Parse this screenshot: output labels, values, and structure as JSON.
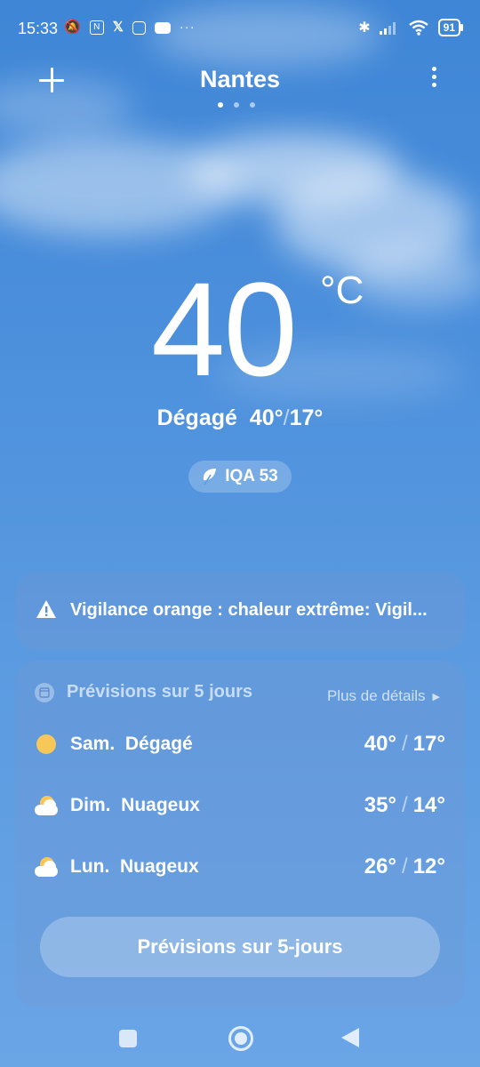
{
  "status_bar": {
    "time": "15:33",
    "battery": "91",
    "left_icons": [
      "alarm-off-icon",
      "nfc-icon",
      "x-icon",
      "instagram-icon",
      "youtube-icon",
      "more-icon"
    ],
    "right_icons": [
      "bluetooth-icon",
      "signal-icon",
      "wifi-icon",
      "battery-icon"
    ]
  },
  "header": {
    "city": "Nantes",
    "pages": 3,
    "active_page": 0
  },
  "current": {
    "temperature": "40",
    "unit": "°C",
    "condition": "Dégagé",
    "high": "40°",
    "separator": "/",
    "low": "17°",
    "aqi_label": "IQA 53"
  },
  "alert": {
    "text": "Vigilance orange : chaleur extrême: Vigil..."
  },
  "forecast": {
    "title": "Prévisions sur 5 jours",
    "details_label": "Plus de détails",
    "days": [
      {
        "label": "Sam.  Dégagé",
        "high": "40°",
        "low": "17°",
        "icon": "sun-icon"
      },
      {
        "label": "Dim.  Nuageux",
        "high": "35°",
        "low": "14°",
        "icon": "partly-cloudy-icon"
      },
      {
        "label": "Lun.  Nuageux",
        "high": "26°",
        "low": "12°",
        "icon": "partly-cloudy-icon"
      }
    ],
    "slash": "/",
    "button_label": "Prévisions sur 5-jours"
  },
  "colors": {
    "sky_top": "#3f86d6",
    "sky_bottom": "#6aa5e6",
    "sun": "#f7c857"
  }
}
